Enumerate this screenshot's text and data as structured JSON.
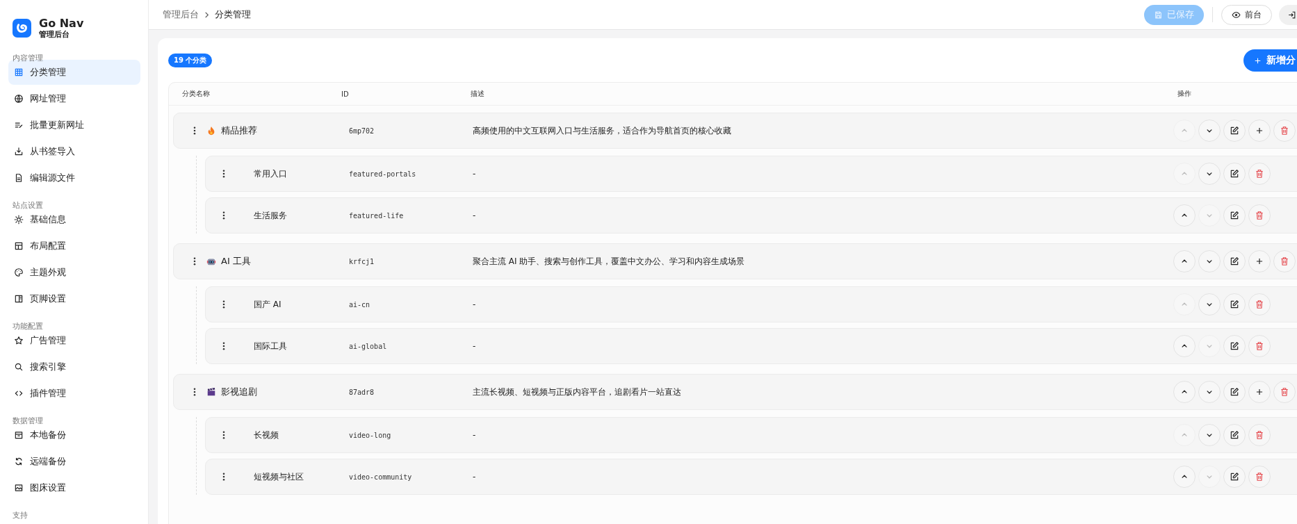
{
  "sidebar": {
    "brand": {
      "name": "Go Nav",
      "subtitle": "管理后台"
    },
    "sections": [
      {
        "title": "内容管理",
        "items": [
          {
            "label": "分类管理",
            "selected": true
          },
          {
            "label": "网址管理",
            "selected": false
          },
          {
            "label": "批量更新网址",
            "selected": false
          },
          {
            "label": "从书签导入",
            "selected": false
          },
          {
            "label": "编辑源文件",
            "selected": false
          }
        ]
      },
      {
        "title": "站点设置",
        "items": [
          {
            "label": "基础信息",
            "selected": false
          },
          {
            "label": "布局配置",
            "selected": false
          },
          {
            "label": "主题外观",
            "selected": false
          },
          {
            "label": "页脚设置",
            "selected": false
          }
        ]
      },
      {
        "title": "功能配置",
        "items": [
          {
            "label": "广告管理",
            "selected": false
          },
          {
            "label": "搜索引擎",
            "selected": false
          },
          {
            "label": "插件管理",
            "selected": false
          }
        ]
      },
      {
        "title": "数据管理",
        "items": [
          {
            "label": "本地备份",
            "selected": false
          },
          {
            "label": "远端备份",
            "selected": false
          },
          {
            "label": "图床设置",
            "selected": false
          }
        ]
      },
      {
        "title": "支持"
      }
    ]
  },
  "topbar": {
    "breadcrumb": [
      {
        "label": "管理后台"
      },
      {
        "label": "分类管理"
      }
    ],
    "save_button": {
      "label": "已保存",
      "disabled": true
    },
    "frontend_button": {
      "label": "前台"
    }
  },
  "toolbar": {
    "count_badge": "19 个分类",
    "add_button": "新增分"
  },
  "table": {
    "columns": [
      "分类名称",
      "ID",
      "描述",
      "操作"
    ],
    "rows": [
      {
        "name": "精品推荐",
        "id": "6mp702",
        "description": "高频使用的中文互联网入口与生活服务，适合作为导航首页的核心收藏",
        "can_move_up": false,
        "can_move_down": true,
        "children": [
          {
            "name": "常用入口",
            "id": "featured-portals",
            "description": "-",
            "can_move_up": false,
            "can_move_down": true
          },
          {
            "name": "生活服务",
            "id": "featured-life",
            "description": "-",
            "can_move_up": true,
            "can_move_down": false
          }
        ]
      },
      {
        "name": "AI 工具",
        "id": "krfcj1",
        "description": "聚合主流 AI 助手、搜索与创作工具，覆盖中文办公、学习和内容生成场景",
        "can_move_up": true,
        "can_move_down": true,
        "children": [
          {
            "name": "国产 AI",
            "id": "ai-cn",
            "description": "-",
            "can_move_up": false,
            "can_move_down": true
          },
          {
            "name": "国际工具",
            "id": "ai-global",
            "description": "-",
            "can_move_up": true,
            "can_move_down": false
          }
        ]
      },
      {
        "name": "影视追剧",
        "id": "87adr8",
        "description": "主流长视频、短视频与正版内容平台，追剧看片一站直达",
        "can_move_up": true,
        "can_move_down": true,
        "children": [
          {
            "name": "长视频",
            "id": "video-long",
            "description": "-",
            "can_move_up": false,
            "can_move_down": true
          },
          {
            "name": "短视频与社区",
            "id": "video-community",
            "description": "-",
            "can_move_up": true,
            "can_move_down": false
          }
        ]
      }
    ]
  }
}
